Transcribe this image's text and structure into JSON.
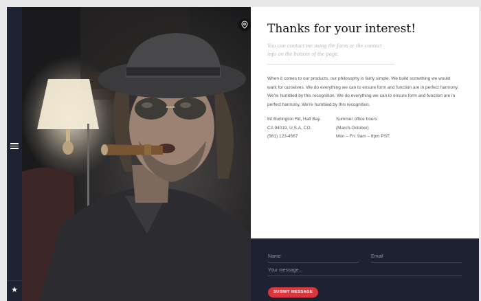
{
  "nav": {
    "menu_icon": "hamburger-menu-icon",
    "star_icon": "star-icon"
  },
  "photo": {
    "pin_icon": "map-pin-icon"
  },
  "content": {
    "title": "Thanks for your interest!",
    "subtitle_lines": [
      "You can contact me using the form or the contact",
      "info on the bottom of the page."
    ],
    "paragraph_lines": [
      "When it comes to our products, our philosophy is fairly simple. We build something we would",
      "want for ourselves. We do everything we can to ensure form and function are in perfect harmony.",
      "We're humbled by this recognition. We do everything we can to ensure form and function are in",
      "perfect harmony. We're humbled by this recognition."
    ],
    "address_lines": [
      "80 Burlington Rd, Half Bay.",
      "CA 94019, U.S.A, CO.",
      "(561) 123-4567"
    ],
    "hours_lines": [
      "Summer office hours",
      "(March-October)",
      "Mon – Fri: 9am – 6pm PST."
    ]
  },
  "form": {
    "name_placeholder": "Name",
    "email_placeholder": "Email",
    "message_placeholder": "Your message...",
    "submit_label": "SUBMIT MESSAGE"
  },
  "colors": {
    "dark_panel": "#1e2131",
    "accent_red": "#d9363e"
  }
}
